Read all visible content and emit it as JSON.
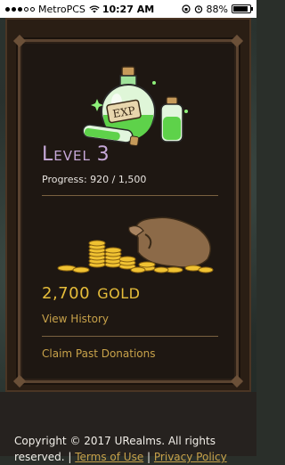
{
  "status_bar": {
    "carrier": "MetroPCS",
    "time": "10:27 AM",
    "battery": "88%",
    "battery_level": 0.88
  },
  "card": {
    "level_label": "Level",
    "level_number": "3",
    "progress_text": "Progress: 920 / 1,500",
    "gold_amount": "2,700",
    "gold_unit": "GOLD",
    "view_history": "View History",
    "claim_donations": "Claim Past Donations",
    "potion_label": "EXP"
  },
  "footer": {
    "copyright": "Copyright © 2017 URealms. All rights reserved.",
    "separator": "|",
    "terms": "Terms of Use",
    "privacy": "Privacy Policy"
  },
  "colors": {
    "level": "#c6a8d8",
    "gold": "#e6bd3a",
    "link": "#c8a24a",
    "card_bg": "#1e1712",
    "frame": "#5a4330"
  }
}
